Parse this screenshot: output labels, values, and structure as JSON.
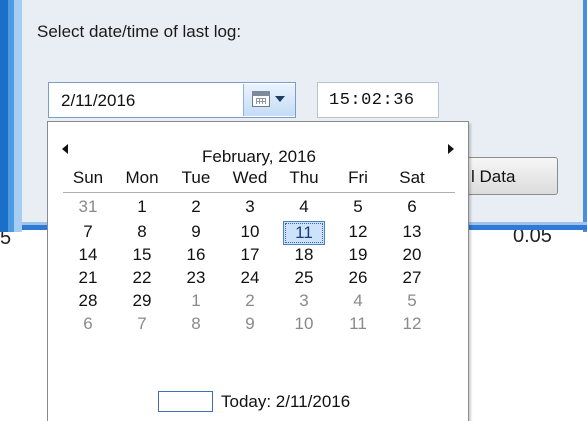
{
  "dialog": {
    "prompt_label": "Select date/time of last log:",
    "date_value": "2/11/2016",
    "time_value": "15:02:36",
    "load_button_label": "l Data"
  },
  "background": {
    "left_value": "5",
    "right_value": "0.05"
  },
  "calendar": {
    "month_title": "February, 2016",
    "weekdays": [
      "Sun",
      "Mon",
      "Tue",
      "Wed",
      "Thu",
      "Fri",
      "Sat"
    ],
    "weeks": [
      [
        "31",
        "1",
        "2",
        "3",
        "4",
        "5",
        "6"
      ],
      [
        "7",
        "8",
        "9",
        "10",
        "11",
        "12",
        "13"
      ],
      [
        "14",
        "15",
        "16",
        "17",
        "18",
        "19",
        "20"
      ],
      [
        "21",
        "22",
        "23",
        "24",
        "25",
        "26",
        "27"
      ],
      [
        "28",
        "29",
        "1",
        "2",
        "3",
        "4",
        "5"
      ],
      [
        "6",
        "7",
        "8",
        "9",
        "10",
        "11",
        "12"
      ]
    ],
    "selected_day": "11",
    "today_label": "Today: 2/11/2016"
  },
  "icons": {
    "prev": "chevron-left-icon",
    "next": "chevron-right-icon",
    "calendar": "calendar-icon"
  },
  "colors": {
    "selection_fill": "#cde3fb",
    "selection_border": "#4d7fc0",
    "window_border": "#2f7ad4"
  }
}
